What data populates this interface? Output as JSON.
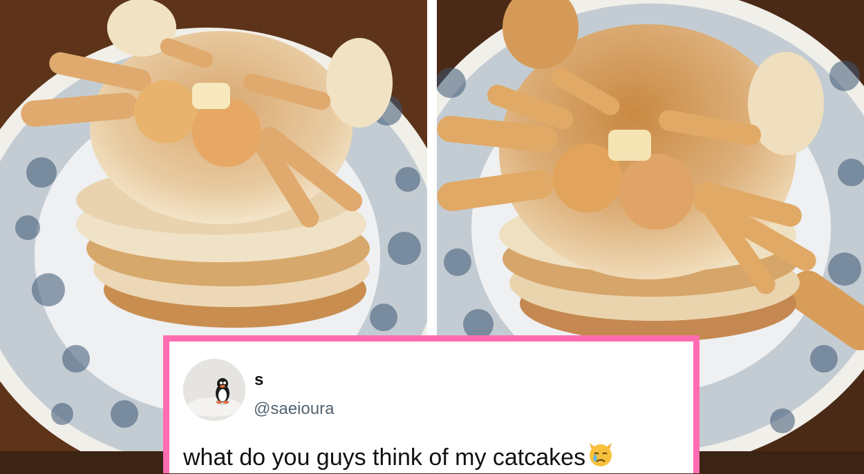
{
  "photos": [
    {
      "icon": "cat-pancake-stack-photo"
    },
    {
      "icon": "cat-pancake-stack-photo"
    }
  ],
  "tweet": {
    "display_name": "s",
    "handle": "@saeioura",
    "text": "what do you guys think of my catcakes",
    "emoji": "crying-cat-face-icon",
    "avatar_icon": "penguin-avatar",
    "border_color": "#ff6db0"
  }
}
